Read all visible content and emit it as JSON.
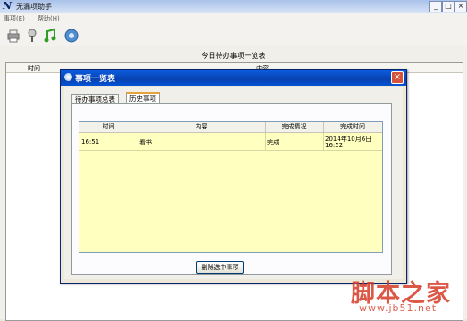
{
  "window": {
    "title": "无漏项助手",
    "minimize": "_",
    "maximize": "□",
    "close": "×"
  },
  "menu": [
    "事项(E)",
    "帮助(H)"
  ],
  "toolbar": {
    "icons": [
      "printer-icon",
      "lamp-icon",
      "music-note-icon",
      "settings-disc-icon"
    ]
  },
  "main": {
    "caption": "今日待办事项一览表",
    "columns": [
      "时间",
      "内容"
    ]
  },
  "dialog": {
    "title": "事项一览表",
    "close": "×",
    "tabs": [
      {
        "label": "待办事项总表",
        "active": false
      },
      {
        "label": "历史事项",
        "active": true
      }
    ],
    "grid": {
      "columns": [
        "时间",
        "内容",
        "完成情况",
        "完成时间"
      ],
      "rows": [
        {
          "time": "16:51",
          "content": "看书",
          "status": "完成",
          "done_time_1": "2014年10月6日",
          "done_time_2": "16:52"
        }
      ]
    },
    "delete_button": "删除选中事项"
  },
  "watermark": {
    "cn": "脚本之家",
    "url": "www.jb51.net"
  }
}
